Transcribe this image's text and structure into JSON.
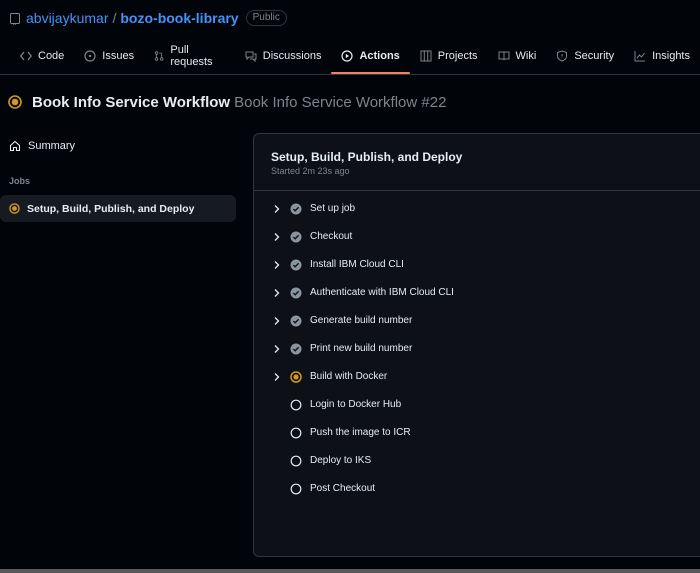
{
  "repo": {
    "owner": "abvijaykumar",
    "separator": "/",
    "name": "bozo-book-library",
    "visibility": "Public"
  },
  "tabs": [
    {
      "label": "Code",
      "icon": "code-icon"
    },
    {
      "label": "Issues",
      "icon": "issue-icon"
    },
    {
      "label": "Pull requests",
      "icon": "pull-request-icon"
    },
    {
      "label": "Discussions",
      "icon": "discussion-icon"
    },
    {
      "label": "Actions",
      "icon": "play-icon",
      "active": true
    },
    {
      "label": "Projects",
      "icon": "table-icon"
    },
    {
      "label": "Wiki",
      "icon": "book-icon"
    },
    {
      "label": "Security",
      "icon": "shield-icon"
    },
    {
      "label": "Insights",
      "icon": "graph-icon"
    }
  ],
  "run": {
    "workflow_name": "Book Info Service Workflow",
    "run_name": "Book Info Service Workflow #22",
    "status": "in_progress"
  },
  "sidebar": {
    "summary_label": "Summary",
    "jobs_heading": "Jobs",
    "jobs": [
      {
        "label": "Setup, Build, Publish, and Deploy",
        "status": "in_progress"
      }
    ]
  },
  "job_panel": {
    "title": "Setup, Build, Publish, and Deploy",
    "started": "Started 2m 23s ago",
    "steps": [
      {
        "label": "Set up job",
        "status": "success"
      },
      {
        "label": "Checkout",
        "status": "success"
      },
      {
        "label": "Install IBM Cloud CLI",
        "status": "success"
      },
      {
        "label": "Authenticate with IBM Cloud CLI",
        "status": "success"
      },
      {
        "label": "Generate build number",
        "status": "success"
      },
      {
        "label": "Print new build number",
        "status": "success"
      },
      {
        "label": "Build with Docker",
        "status": "in_progress"
      },
      {
        "label": "Login to Docker Hub",
        "status": "pending"
      },
      {
        "label": "Push the image to ICR",
        "status": "pending"
      },
      {
        "label": "Deploy to IKS",
        "status": "pending"
      },
      {
        "label": "Post Checkout",
        "status": "pending"
      }
    ]
  },
  "colors": {
    "background": "#010409",
    "panel": "#0d1117",
    "border": "#30363d",
    "link": "#4493f8",
    "in_progress": "#d29922",
    "success": "#8b949e",
    "active_tab_underline": "#f78166"
  }
}
